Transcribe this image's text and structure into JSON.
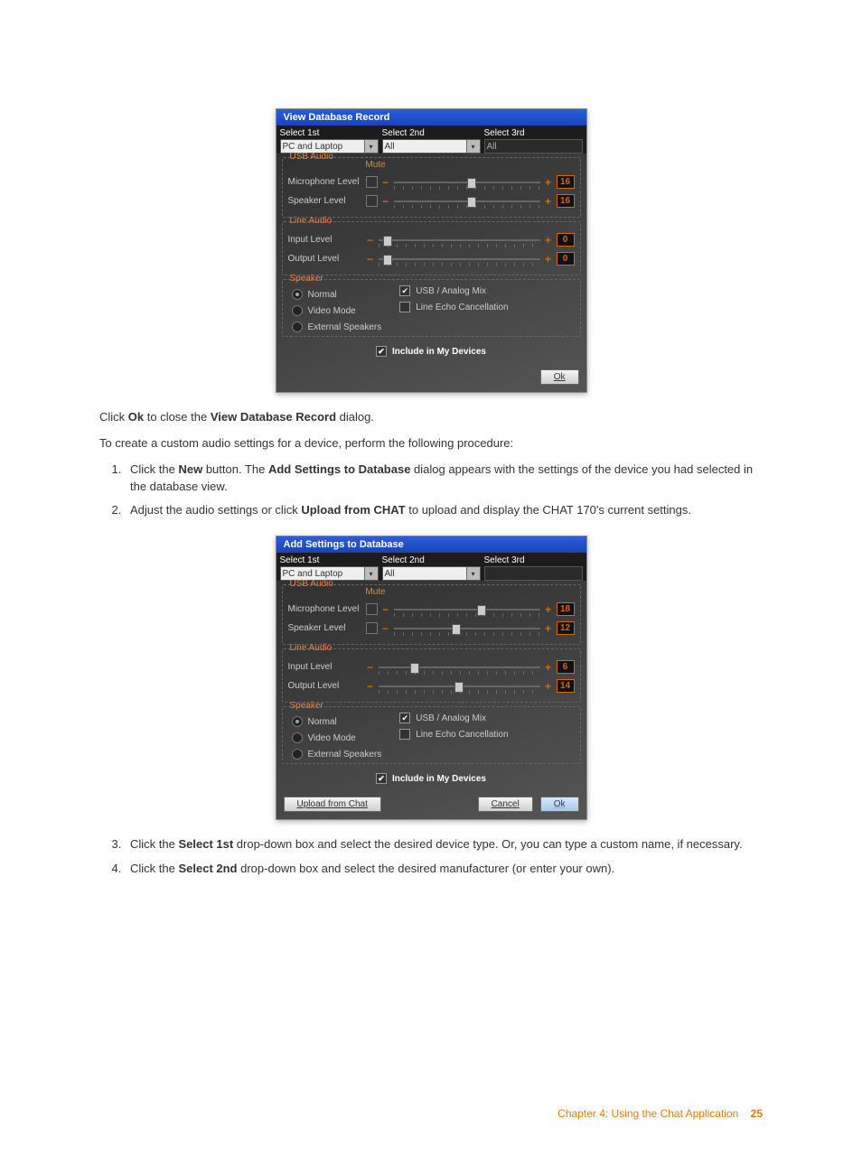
{
  "dialog1": {
    "title": "View Database Record",
    "select_labels": [
      "Select 1st",
      "Select 2nd",
      "Select 3rd"
    ],
    "select_values": [
      "PC and Laptop",
      "All",
      "All"
    ],
    "usb_audio": {
      "title": "USB Audio",
      "mute_header": "Mute",
      "rows": [
        {
          "label": "Microphone Level",
          "value": "16",
          "thumb_pct": 50,
          "has_mute": true
        },
        {
          "label": "Speaker Level",
          "value": "16",
          "thumb_pct": 50,
          "has_mute": true
        }
      ]
    },
    "line_audio": {
      "title": "Line Audio",
      "rows": [
        {
          "label": "Input Level",
          "value": "0",
          "thumb_pct": 3
        },
        {
          "label": "Output Level",
          "value": "0",
          "thumb_pct": 3
        }
      ]
    },
    "speaker": {
      "title": "Speaker",
      "radios": [
        {
          "label": "Normal",
          "checked": true
        },
        {
          "label": "Video Mode",
          "checked": false
        },
        {
          "label": "External Speakers",
          "checked": false
        }
      ],
      "checks": [
        {
          "label": "USB / Analog Mix",
          "checked": true
        },
        {
          "label": "Line Echo Cancellation",
          "checked": false
        }
      ]
    },
    "include_label": "Include in My Devices",
    "include_checked": true,
    "ok_label": "Ok"
  },
  "text1": {
    "pre": "Click ",
    "bold1": "Ok",
    "mid": " to close the ",
    "bold2": "View Database Record",
    "post": " dialog."
  },
  "text2": "To create a custom audio settings for a device, perform the following procedure:",
  "steps_a": [
    {
      "pre": "Click the ",
      "b1": "New",
      "mid": " button. The ",
      "b2": "Add Settings to Database",
      "post": " dialog appears with the settings of the device you had selected in the database view."
    },
    {
      "pre": "Adjust the audio settings or click ",
      "b1": "Upload from CHAT",
      "mid": " to upload and display the CHAT 170's current settings.",
      "b2": "",
      "post": ""
    }
  ],
  "dialog2": {
    "title": "Add Settings to Database",
    "select_labels": [
      "Select 1st",
      "Select 2nd",
      "Select 3rd"
    ],
    "select_values": [
      "PC and Laptop",
      "All",
      ""
    ],
    "usb_audio": {
      "title": "USB Audio",
      "mute_header": "Mute",
      "rows": [
        {
          "label": "Microphone Level",
          "value": "18",
          "thumb_pct": 57,
          "has_mute": true
        },
        {
          "label": "Speaker Level",
          "value": "12",
          "thumb_pct": 40,
          "has_mute": true
        }
      ]
    },
    "line_audio": {
      "title": "Line Audio",
      "rows": [
        {
          "label": "Input Level",
          "value": "6",
          "thumb_pct": 20
        },
        {
          "label": "Output Level",
          "value": "14",
          "thumb_pct": 47
        }
      ]
    },
    "speaker": {
      "title": "Speaker",
      "radios": [
        {
          "label": "Normal",
          "checked": true
        },
        {
          "label": "Video Mode",
          "checked": false
        },
        {
          "label": "External Speakers",
          "checked": false
        }
      ],
      "checks": [
        {
          "label": "USB / Analog Mix",
          "checked": true
        },
        {
          "label": "Line Echo Cancellation",
          "checked": false
        }
      ]
    },
    "include_label": "Include in My Devices",
    "include_checked": true,
    "upload_label": "Upload from Chat",
    "cancel_label": "Cancel",
    "ok_label": "Ok"
  },
  "steps_b": [
    {
      "pre": "Click the ",
      "b1": "Select 1st",
      "post": " drop-down box and select the desired device type. Or, you can type a custom name, if necessary."
    },
    {
      "pre": "Click the ",
      "b1": "Select 2nd",
      "post": " drop-down box and select the desired manufacturer (or enter your own)."
    }
  ],
  "footer": {
    "chapter": "Chapter 4: Using the Chat Application",
    "page": "25"
  }
}
